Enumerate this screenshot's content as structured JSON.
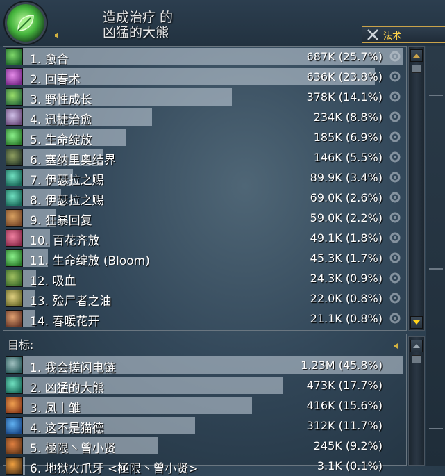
{
  "header": {
    "title_line1": "造成治疗 的",
    "title_line2": "凶猛的大熊",
    "mode_label": "法术"
  },
  "spells": {
    "rows": [
      {
        "label": "1. 愈合",
        "value": "687K (25.7%)",
        "pct": 100
      },
      {
        "label": "2. 回春术",
        "value": "636K (23.8%)",
        "pct": 92.6
      },
      {
        "label": "3. 野性成长",
        "value": "378K (14.1%)",
        "pct": 55
      },
      {
        "label": "4. 迅捷治愈",
        "value": "234K (8.8%)",
        "pct": 34
      },
      {
        "label": "5. 生命绽放",
        "value": "185K (6.9%)",
        "pct": 27
      },
      {
        "label": "6. 塞纳里奥结界",
        "value": "146K (5.5%)",
        "pct": 21.2
      },
      {
        "label": "7. 伊瑟拉之赐",
        "value": "89.9K (3.4%)",
        "pct": 13.1
      },
      {
        "label": "8. 伊瑟拉之赐",
        "value": "69.0K (2.6%)",
        "pct": 10
      },
      {
        "label": "9. 狂暴回复",
        "value": "59.0K (2.2%)",
        "pct": 8.6
      },
      {
        "label": "10. 百花齐放",
        "value": "49.1K (1.8%)",
        "pct": 7.1
      },
      {
        "label": "11. 生命绽放 (Bloom)",
        "value": "45.3K (1.7%)",
        "pct": 6.6
      },
      {
        "label": "12. 吸血",
        "value": "24.3K (0.9%)",
        "pct": 3.5
      },
      {
        "label": "13. 殓尸者之油",
        "value": "22.0K (0.8%)",
        "pct": 3.2
      },
      {
        "label": "14. 春暖花开",
        "value": "21.1K (0.8%)",
        "pct": 3.1
      }
    ]
  },
  "targets": {
    "header": "目标:",
    "rows": [
      {
        "label": "1. 我会搓闪电链",
        "value": "1.23M (45.8%)",
        "pct": 100
      },
      {
        "label": "2. 凶猛的大熊",
        "value": "473K (17.7%)",
        "pct": 68.5
      },
      {
        "label": "3. 凤丨雏",
        "value": "416K (15.6%)",
        "pct": 60.2
      },
      {
        "label": "4. 这不是猫德",
        "value": "312K (11.7%)",
        "pct": 45.2
      },
      {
        "label": "5. 極限丶曾小贤",
        "value": "245K (9.2%)",
        "pct": 35.5
      },
      {
        "label": "6. 地狱火爪牙 <極限丶曾小贤>",
        "value": "3.1K (0.1%)",
        "pct": 0.5
      }
    ]
  },
  "colors": {
    "accent": "#c9a24a",
    "bar": "#c8d4de"
  }
}
